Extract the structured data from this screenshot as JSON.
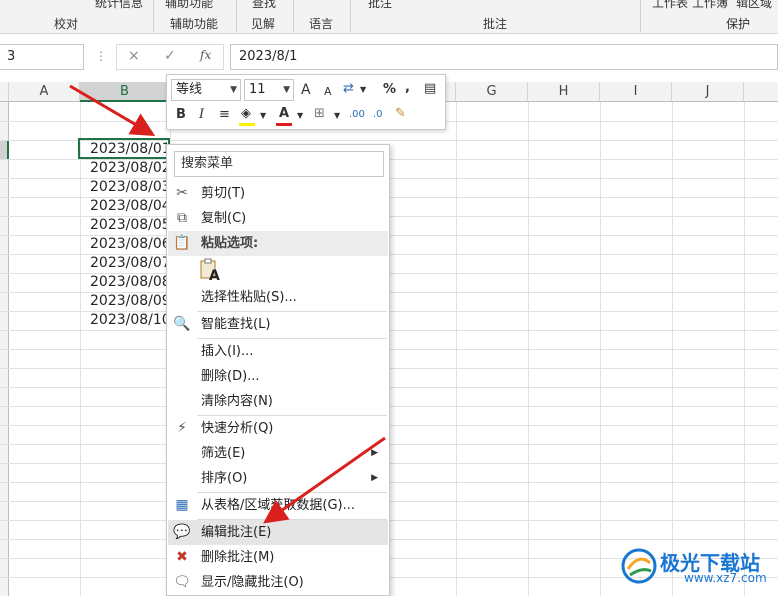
{
  "ribbon": {
    "top_items": [
      "统计信息",
      "辅助功能",
      "查找",
      "批注",
      "工作表",
      "工作簿",
      "辑区域"
    ],
    "groups": [
      "校对",
      "辅助功能",
      "见解",
      "语言",
      "批注",
      "保护"
    ]
  },
  "formula_bar": {
    "name_box": "3",
    "cancel_icon": "×",
    "enter_icon": "✓",
    "fx": "fx",
    "value": "2023/8/1"
  },
  "columns": [
    "A",
    "B",
    "G",
    "H",
    "I",
    "J"
  ],
  "cells": [
    "2023/08/01",
    "2023/08/02",
    "2023/08/03",
    "2023/08/04",
    "2023/08/05",
    "2023/08/06",
    "2023/08/07",
    "2023/08/08",
    "2023/08/09",
    "2023/08/10"
  ],
  "mini_toolbar": {
    "font_name": "等线",
    "font_size": "11",
    "grow_font": "A",
    "shrink_font": "A",
    "percent": "%",
    "comma": ",",
    "bold": "B",
    "italic": "I",
    "font_color_letter": "A",
    "decimal_increase": ".00",
    "decimal_decrease": ".0",
    "accent_fill": "#ffef00",
    "accent_font": "#e31b1b"
  },
  "context_menu": {
    "search_placeholder": "搜索菜单",
    "items": [
      {
        "label": "剪切(T)",
        "icon": "scissors-icon"
      },
      {
        "label": "复制(C)",
        "icon": "copy-icon"
      },
      {
        "label": "粘贴选项:",
        "icon": "paste-icon"
      },
      {
        "label": "选择性粘贴(S)...",
        "icon": ""
      },
      {
        "label": "智能查找(L)",
        "icon": "smart-lookup-icon"
      },
      {
        "label": "插入(I)...",
        "icon": ""
      },
      {
        "label": "删除(D)...",
        "icon": ""
      },
      {
        "label": "清除内容(N)",
        "icon": ""
      },
      {
        "label": "快速分析(Q)",
        "icon": "quick-analysis-icon"
      },
      {
        "label": "筛选(E)",
        "icon": ""
      },
      {
        "label": "排序(O)",
        "icon": ""
      },
      {
        "label": "从表格/区域获取数据(G)...",
        "icon": "table-icon"
      },
      {
        "label": "编辑批注(E)",
        "icon": "edit-comment-icon"
      },
      {
        "label": "删除批注(M)",
        "icon": "delete-comment-icon"
      },
      {
        "label": "显示/隐藏批注(O)",
        "icon": "show-comment-icon"
      }
    ],
    "paste_glyph": "A"
  },
  "watermark": {
    "name": "极光下载站",
    "url": "www.xz7.com"
  },
  "colors": {
    "excel_green": "#217346",
    "arrow_red": "#d9201c"
  }
}
